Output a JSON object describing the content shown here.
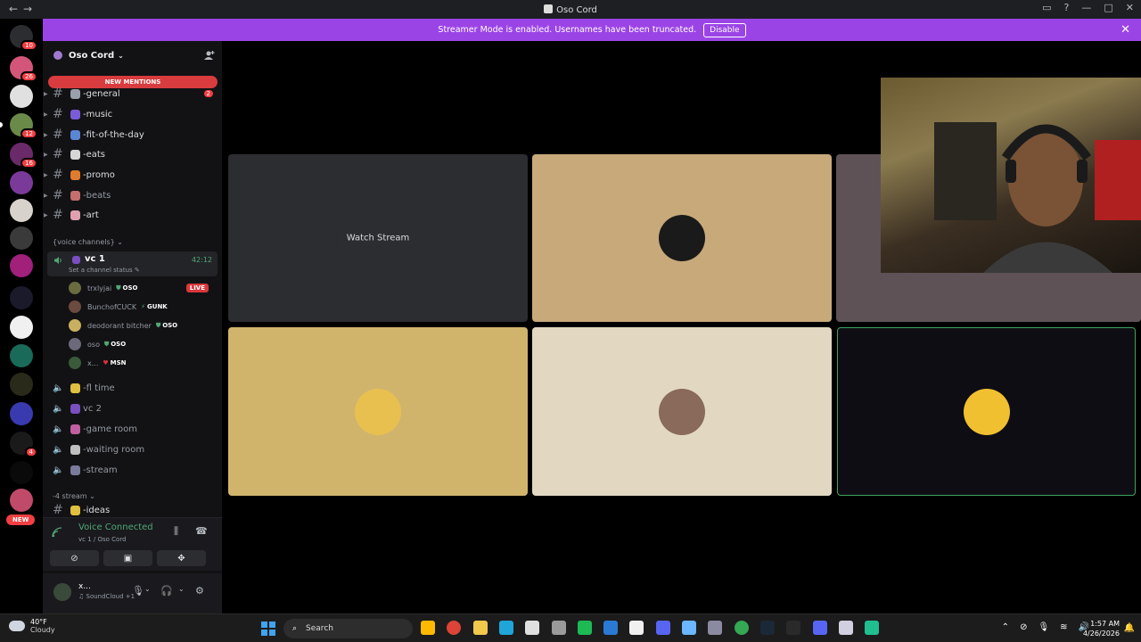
{
  "window": {
    "title": "Oso Cord"
  },
  "banner": {
    "text": "Streamer Mode is enabled. Usernames have been truncated.",
    "disable_label": "Disable"
  },
  "server_rail": {
    "badges": [
      "10",
      "26",
      "12",
      "16",
      "4"
    ],
    "new_label": "NEW"
  },
  "guild": {
    "name": "Oso Cord",
    "new_mentions": "NEW MENTIONS"
  },
  "text_channels": [
    {
      "name": "-general",
      "badge": "2",
      "emoji_color": "#9aa0aa"
    },
    {
      "name": "-music",
      "emoji_color": "#7a5cd6"
    },
    {
      "name": "-fit-of-the-day",
      "emoji_color": "#5a86d6"
    },
    {
      "name": "-eats",
      "emoji_color": "#d6d6d6"
    },
    {
      "name": "-promo",
      "emoji_color": "#e07b2e"
    },
    {
      "name": "-beats",
      "emoji_color": "#c46e6e"
    },
    {
      "name": "-art",
      "emoji_color": "#e0a0b0"
    }
  ],
  "voice_category": "{voice channels}",
  "active_vc": {
    "name": "vc 1",
    "status": "Set a channel status",
    "timer": "42:12"
  },
  "members": [
    {
      "name": "trxlyjai",
      "tag": "OSO",
      "tag_icon": "shield",
      "live": "LIVE",
      "color": "#6b6b40"
    },
    {
      "name": "BunchofCUCK",
      "tag": "GUNK",
      "tag_icon": "bolt",
      "color": "#6b4a40"
    },
    {
      "name": "deodorant bitcher",
      "tag": "OSO",
      "tag_icon": "shield",
      "color": "#c8b060"
    },
    {
      "name": "oso",
      "tag": "OSO",
      "tag_icon": "shield",
      "color": "#6a6a7a"
    },
    {
      "name": "x...",
      "tag": "MSN",
      "tag_icon": "heart",
      "color": "#3a5a3a"
    }
  ],
  "voice_channels": [
    "-fl time",
    "vc 2",
    "-game room",
    "-waiting room",
    "-stream"
  ],
  "stream_category": "-4 stream",
  "partial_channel": "-ideas",
  "voice_bar": {
    "connected": "Voice Connected",
    "location": "vc 1 / Oso Cord"
  },
  "user": {
    "name": "x...",
    "status": "SoundCloud +1"
  },
  "stage": {
    "watch_stream": "Watch Stream",
    "tile_colors": [
      "#2b2d31",
      "#c8a97a",
      "#5e5257",
      "#d1b46c",
      "#e2d8c2",
      "#0f0d14"
    ]
  },
  "taskbar": {
    "temp": "40°F",
    "condition": "Cloudy",
    "search_placeholder": "Search",
    "time": "1:57 AM",
    "date": "4/26/2026"
  }
}
